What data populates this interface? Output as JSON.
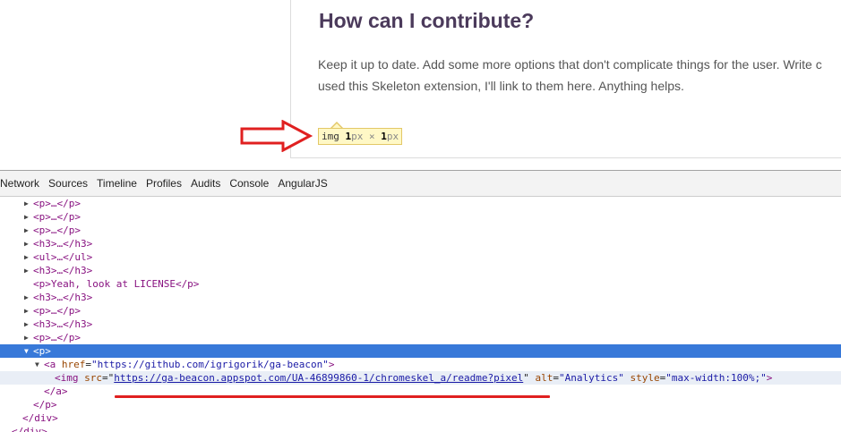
{
  "page": {
    "heading": "How can I contribute?",
    "paragraph_line1": "Keep it up to date. Add some more options that don't complicate things for the user. Write c",
    "paragraph_line2": "used this Skeleton extension, I'll link to them here. Anything helps."
  },
  "tooltip": {
    "tag": "img",
    "width": "1",
    "unit": "px",
    "times": "×",
    "height": "1"
  },
  "annotation": {
    "arrow_color": "#e02020",
    "underline_color": "#e02020"
  },
  "devtools": {
    "tabs": [
      "Network",
      "Sources",
      "Timeline",
      "Profiles",
      "Audits",
      "Console",
      "AngularJS"
    ],
    "rows": [
      "<p>…</p>",
      "<p>…</p>",
      "<p>…</p>",
      "<h3>…</h3>",
      "<ul>…</ul>",
      "<h3>…</h3>",
      "<p>Yeah, look at LICENSE</p>",
      "<h3>…</h3>",
      "<p>…</p>",
      "<h3>…</h3>",
      "<p>…</p>",
      "<p>",
      "</a>",
      "</p>",
      "</div>",
      "</div>"
    ],
    "anchor": {
      "open": "<a ",
      "attr": "href",
      "eq": "=",
      "value": "\"https://github.com/igrigorik/ga-beacon\"",
      "close": ">"
    },
    "img": {
      "open": "<img ",
      "src_attr": "src",
      "src_value": "https://ga-beacon.appspot.com/UA-46899860-1/chromeskel_a/readme?pixel",
      "alt_attr": "alt",
      "alt_value": "\"Analytics\"",
      "style_attr": "style",
      "style_value": "\"max-width:100%;\"",
      "close": ">"
    },
    "selection_color": "#3879d9"
  }
}
